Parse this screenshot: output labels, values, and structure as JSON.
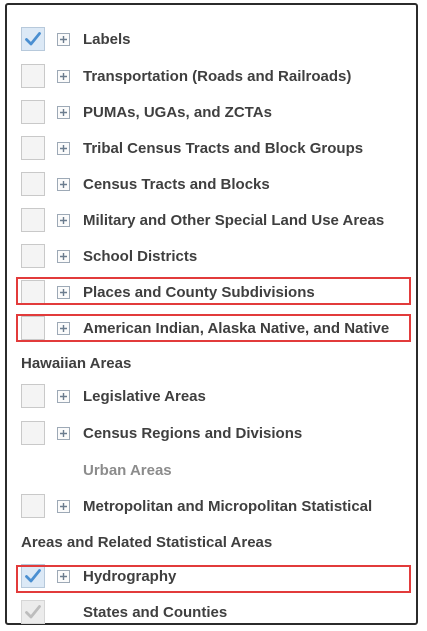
{
  "layers": [
    {
      "label": "Labels",
      "checked": true,
      "expander": true
    },
    {
      "label": "Transportation (Roads and Railroads)",
      "checked": false,
      "expander": true
    },
    {
      "label": "PUMAs, UGAs, and ZCTAs",
      "checked": false,
      "expander": true
    },
    {
      "label": "Tribal Census Tracts and Block Groups",
      "checked": false,
      "expander": true
    },
    {
      "label": "Census Tracts and Blocks",
      "checked": false,
      "expander": true
    },
    {
      "label": "Military and Other Special Land Use Areas",
      "checked": false,
      "expander": true
    },
    {
      "label": "School Districts",
      "checked": false,
      "expander": true
    },
    {
      "label": "Places and County Subdivisions",
      "checked": false,
      "expander": true,
      "highlighted": true
    },
    {
      "label": "American Indian, Alaska Native, and Native",
      "label_continued": "Hawaiian Areas",
      "checked": false,
      "expander": true,
      "highlighted": true
    },
    {
      "label": "Legislative Areas",
      "checked": false,
      "expander": true
    },
    {
      "label": "Census Regions and Divisions",
      "checked": false,
      "expander": true
    },
    {
      "label": "Urban Areas",
      "checkbox": false,
      "expander": false,
      "muted": true
    },
    {
      "label": "Metropolitan and Micropolitan Statistical",
      "label_continued": "Areas and Related Statistical Areas",
      "checked": false,
      "expander": true
    },
    {
      "label": "Hydrography",
      "checked": true,
      "expander": true
    },
    {
      "label": "States and Counties",
      "checked": true,
      "disabled": true,
      "expander": false,
      "highlighted": true
    }
  ],
  "colors": {
    "highlight": "#e23b3b",
    "check": "#4a8fd1",
    "check_disabled": "#bdbdbd",
    "text": "#3f3f3f",
    "muted_text": "#8c8c8c"
  },
  "icons": {
    "checkbox_checked": "checkmark-icon",
    "expander": "plus-icon"
  }
}
